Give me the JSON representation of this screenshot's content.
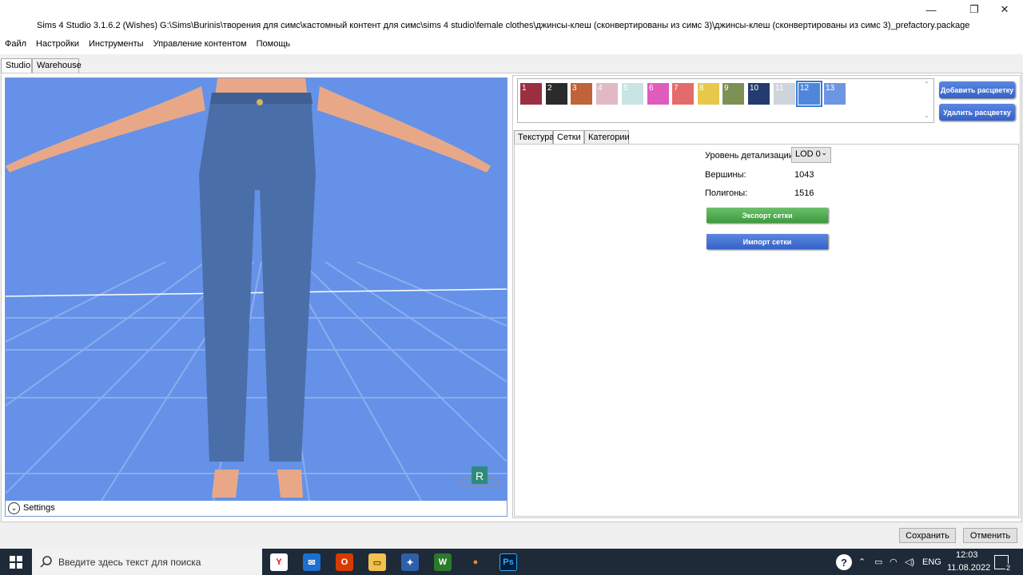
{
  "window": {
    "title": "Sims 4 Studio 3.1.6.2 (Wishes)  G:\\Sims\\Burinis\\творения для симс\\кастомный контент для симс\\sims 4 studio\\female clothes\\джинсы-клеш (сконвертированы из симс 3)\\джинсы-клеш (сконвертированы из симс 3)_prefactory.package",
    "minimize": "—",
    "restore": "❐",
    "close": "✕"
  },
  "menu": [
    "Файл",
    "Настройки",
    "Инструменты",
    "Управление контентом",
    "Помощь"
  ],
  "main_tabs": [
    "Studio",
    "Warehouse"
  ],
  "viewport": {
    "settings_label": "Settings",
    "settings_icon": "chevron-down-icon",
    "badge": "R"
  },
  "swatches": [
    {
      "label": "1",
      "color": "#9b2f3f"
    },
    {
      "label": "2",
      "color": "#2b2b2b"
    },
    {
      "label": "3",
      "color": "#c0623a"
    },
    {
      "label": "4",
      "color": "#e0b9c5"
    },
    {
      "label": "5",
      "color": "#c9e4e4"
    },
    {
      "label": "6",
      "color": "#e05cbc"
    },
    {
      "label": "7",
      "color": "#e36b6b"
    },
    {
      "label": "8",
      "color": "#e6c84a"
    },
    {
      "label": "9",
      "color": "#7e9155"
    },
    {
      "label": "10",
      "color": "#233b6e"
    },
    {
      "label": "11",
      "color": "#cfd3dc"
    },
    {
      "label": "12",
      "color": "#4f86db"
    },
    {
      "label": "13",
      "color": "#6e95e2"
    }
  ],
  "selected_swatch": "12",
  "swatch_buttons": {
    "add": "Добавить расцветку",
    "remove": "Удалить расцветку"
  },
  "inner_tabs": [
    "Текстура",
    "Сетки",
    "Категории"
  ],
  "mesh": {
    "lod_label": "Уровень детализации:",
    "lod_value": "LOD 0",
    "vertices_label": "Вершины:",
    "vertices_value": "1043",
    "polygons_label": "Полигоны:",
    "polygons_value": "1516",
    "export_button": "Экспорт сетки",
    "import_button": "Импорт сетки"
  },
  "footer": {
    "save": "Сохранить",
    "cancel": "Отменить"
  },
  "taskbar": {
    "search_placeholder": "Введите здесь текст для поиска",
    "apps": [
      "Y",
      "✉",
      "O",
      "▭",
      "✦",
      "W",
      "●",
      "Ps"
    ],
    "tray_lang": "ENG",
    "time": "12:03",
    "date": "11.08.2022",
    "notifications": "2"
  },
  "colors": {
    "scene_bg": "#6592e8",
    "accent_blue": "#3562c8",
    "export_green": "#3c9b3c",
    "jeans": "#4a6ea8"
  }
}
